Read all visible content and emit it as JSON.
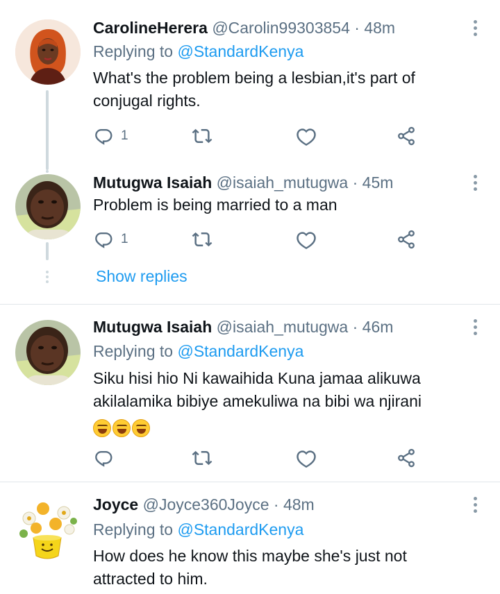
{
  "tweets": [
    {
      "name": "CarolineHerera",
      "handle": "@Carolin99303854",
      "dot": "·",
      "time": "48m",
      "replying_prefix": "Replying to",
      "replying_to": "@StandardKenya",
      "text_lines": [
        "What's the problem being a lesbian,it's part of",
        "conjugal rights."
      ],
      "reply_count": "1",
      "avatar_icon": "avatar-woman"
    },
    {
      "name": "Mutugwa Isaiah",
      "handle": "@isaiah_mutugwa",
      "dot": "·",
      "time": "45m",
      "text_lines": [
        "Problem is being married to a man"
      ],
      "reply_count": "1",
      "avatar_icon": "avatar-man"
    },
    {
      "show_replies": "Show replies"
    },
    {
      "name": "Mutugwa Isaiah",
      "handle": "@isaiah_mutugwa",
      "dot": "·",
      "time": "46m",
      "replying_prefix": "Replying to",
      "replying_to": "@StandardKenya",
      "text_lines": [
        "Siku hisi hio Ni kawaihida  Kuna jamaa alikuwa",
        "akilalamika bibiye amekuliwa na bibi wa njirani"
      ],
      "emoji": [
        "rolling-on-floor-laughing",
        "grinning-squinting",
        "rolling-on-floor-laughing"
      ],
      "avatar_icon": "avatar-man"
    },
    {
      "name": "Joyce",
      "handle": "@Joyce360Joyce",
      "dot": "·",
      "time": "48m",
      "replying_prefix": "Replying to",
      "replying_to": "@StandardKenya",
      "text_lines": [
        "How does he know this maybe she's just not",
        "attracted to him."
      ],
      "avatar_icon": "avatar-flowers"
    }
  ],
  "colors": {
    "link": "#1d9bf0",
    "secondary_text": "#5b7083",
    "primary_text": "#0f1419",
    "divider": "#e1e6ea"
  },
  "icons": [
    "reply-icon",
    "retweet-icon",
    "like-icon",
    "share-icon",
    "more-icon"
  ]
}
